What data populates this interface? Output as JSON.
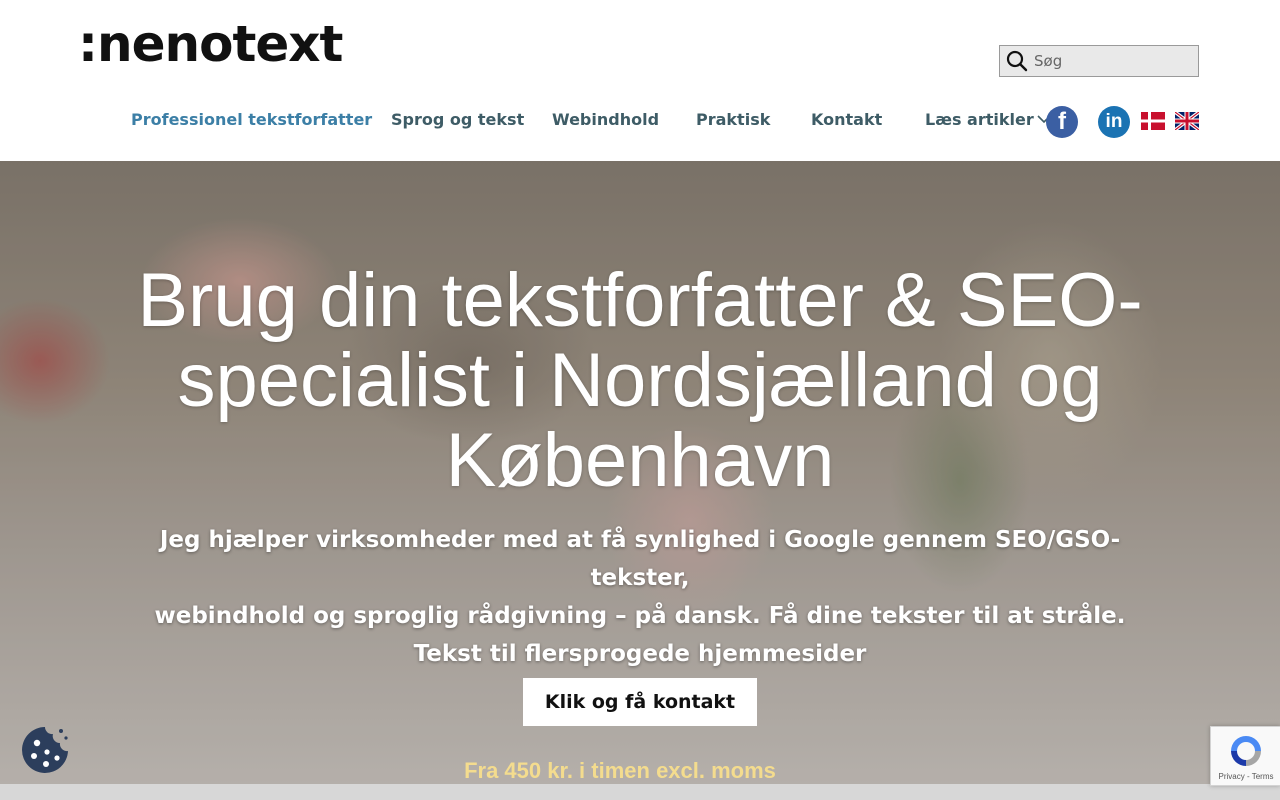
{
  "header": {
    "logo_text": ":nenotext",
    "search_placeholder": "Søg"
  },
  "nav": {
    "items": [
      {
        "label": "Professionel tekstforfatter",
        "active": true
      },
      {
        "label": "Sprog og tekst"
      },
      {
        "label": "Webindhold"
      },
      {
        "label": "Praktisk"
      },
      {
        "label": "Kontakt"
      },
      {
        "label": "Læs artikler",
        "has_dropdown": true
      }
    ],
    "social": {
      "facebook_glyph": "f",
      "linkedin_glyph": "in"
    },
    "languages": [
      "danish-flag-icon",
      "uk-flag-icon"
    ]
  },
  "hero": {
    "title": "Brug din tekstforfatter & SEO-specialist i Nordsjælland og København",
    "lead_line1": "Jeg hjælper virksomheder med at få synlighed i Google gennem SEO/GSO-tekster,",
    "lead_line2": "webindhold og sproglig rådgivning – på dansk. Få dine tekster til at stråle.",
    "lead_line3": "Tekst til flersprogede hjemmesider",
    "cta_label": "Klik og få kontakt",
    "price": "Fra 450 kr. i timen excl. moms"
  },
  "recaptcha": {
    "links": "Privacy - Terms"
  },
  "colors": {
    "nav_text": "#3e5c66",
    "nav_active": "#3c7fa6",
    "facebook": "#3b5fa3",
    "linkedin": "#1b73b3",
    "price_text": "#f4dc8e",
    "cookie_badge": "#2c3e5c"
  }
}
